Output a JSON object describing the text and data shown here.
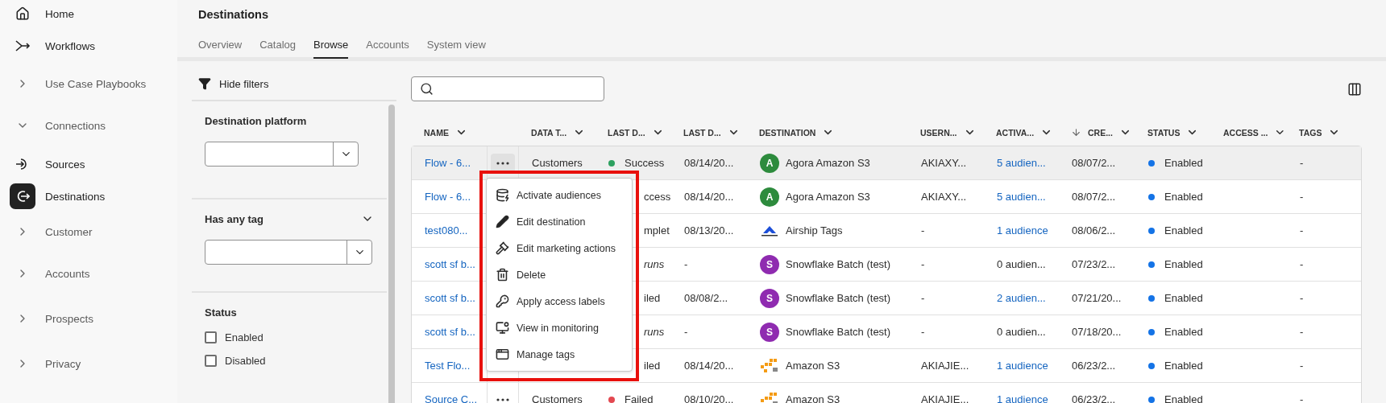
{
  "sidebar": {
    "items": [
      {
        "label": "Home",
        "kind": "link",
        "selected": false
      },
      {
        "label": "Workflows",
        "kind": "link",
        "selected": false
      },
      {
        "label": "Use Case Playbooks",
        "kind": "group",
        "expanded": false,
        "selected": false
      },
      {
        "label": "Connections",
        "kind": "group",
        "expanded": true,
        "selected": false
      },
      {
        "label": "Sources",
        "kind": "link",
        "selected": false
      },
      {
        "label": "Destinations",
        "kind": "link",
        "selected": true
      },
      {
        "label": "Customer",
        "kind": "group",
        "expanded": false,
        "selected": false
      },
      {
        "label": "Accounts",
        "kind": "group",
        "expanded": false,
        "selected": false
      },
      {
        "label": "Prospects",
        "kind": "group",
        "expanded": false,
        "selected": false
      },
      {
        "label": "Privacy",
        "kind": "group",
        "expanded": false,
        "selected": false
      }
    ]
  },
  "page": {
    "title": "Destinations"
  },
  "tabs": [
    {
      "label": "Overview",
      "selected": false
    },
    {
      "label": "Catalog",
      "selected": false
    },
    {
      "label": "Browse",
      "selected": true
    },
    {
      "label": "Accounts",
      "selected": false
    },
    {
      "label": "System view",
      "selected": false
    }
  ],
  "filters": {
    "toggle": "Hide filters",
    "sections": [
      {
        "kind": "select",
        "label": "Destination platform"
      },
      {
        "kind": "select",
        "label": "Has any tag",
        "expanded": true
      },
      {
        "kind": "checks",
        "label": "Status",
        "options": [
          {
            "label": "Enabled",
            "checked": false
          },
          {
            "label": "Disabled",
            "checked": false
          }
        ]
      }
    ]
  },
  "table": {
    "columns": [
      {
        "label": "NAME",
        "sorted": false
      },
      {},
      {
        "label": "DATA T...",
        "sorted": false
      },
      {
        "label": "LAST D...",
        "sorted": false
      },
      {
        "label": "LAST D...",
        "sorted": false
      },
      {
        "label": "DESTINATION",
        "sorted": false
      },
      {
        "label": "USERN...",
        "sorted": false
      },
      {
        "label": "ACTIVA...",
        "sorted": false
      },
      {
        "label": "CRE...",
        "sorted": true
      },
      {
        "label": "STATUS",
        "sorted": false
      },
      {
        "label": "ACCESS ...",
        "sorted": false
      },
      {
        "label": "TAGS",
        "sorted": false
      }
    ],
    "rows": [
      {
        "name": "Flow - 6...",
        "selected": true,
        "more": {
          "active": true
        },
        "data_type": "Customers",
        "last_status": {
          "text": "Success",
          "color": "#2da160",
          "italic": false
        },
        "last_date": "08/14/20...",
        "destination": {
          "name": "Agora Amazon S3",
          "kind": "letter",
          "letter": "A",
          "color": "#2d8b3d"
        },
        "username": "AKIAXY...",
        "activation": {
          "text": "5 audien...",
          "link": true
        },
        "created": "08/07/2...",
        "status": {
          "text": "Enabled",
          "color": "#1473e6"
        },
        "tags": "-"
      },
      {
        "name": "Flow - 6...",
        "selected": false,
        "last_status": {
          "text": "ccess",
          "italic": false
        },
        "last_date": "08/14/20...",
        "destination": {
          "name": "Agora Amazon S3",
          "kind": "letter",
          "letter": "A",
          "color": "#2d8b3d"
        },
        "username": "AKIAXY...",
        "activation": {
          "text": "5 audien...",
          "link": true
        },
        "created": "08/07/2...",
        "status": {
          "text": "Enabled",
          "color": "#1473e6"
        },
        "tags": "-"
      },
      {
        "name": "test080...",
        "selected": false,
        "last_status": {
          "text": "mplet",
          "italic": false
        },
        "last_date": "08/13/20...",
        "destination": {
          "name": "Airship Tags",
          "kind": "airship"
        },
        "username": "-",
        "activation": {
          "text": "1 audience",
          "link": true
        },
        "created": "08/06/2...",
        "status": {
          "text": "Enabled",
          "color": "#1473e6"
        },
        "tags": "-"
      },
      {
        "name": "scott sf b...",
        "selected": false,
        "last_status": {
          "text": "runs",
          "italic": true
        },
        "last_date": "-",
        "destination": {
          "name": "Snowflake Batch (test)",
          "kind": "letter",
          "letter": "S",
          "color": "#8f2bb0"
        },
        "username": "-",
        "activation": {
          "text": "0 audien...",
          "link": false
        },
        "created": "07/23/2...",
        "status": {
          "text": "Enabled",
          "color": "#1473e6"
        },
        "tags": "-"
      },
      {
        "name": "scott sf b...",
        "selected": false,
        "last_status": {
          "text": "iled",
          "italic": false
        },
        "last_date": "08/08/2...",
        "destination": {
          "name": "Snowflake Batch (test)",
          "kind": "letter",
          "letter": "S",
          "color": "#8f2bb0"
        },
        "username": "-",
        "activation": {
          "text": "2 audien...",
          "link": true
        },
        "created": "07/21/20...",
        "status": {
          "text": "Enabled",
          "color": "#1473e6"
        },
        "tags": "-"
      },
      {
        "name": "scott sf b...",
        "selected": false,
        "last_status": {
          "text": "runs",
          "italic": true
        },
        "last_date": "-",
        "destination": {
          "name": "Snowflake Batch (test)",
          "kind": "letter",
          "letter": "S",
          "color": "#8f2bb0"
        },
        "username": "-",
        "activation": {
          "text": "0 audien...",
          "link": false
        },
        "created": "07/18/20...",
        "status": {
          "text": "Enabled",
          "color": "#1473e6"
        },
        "tags": "-"
      },
      {
        "name": "Test Flo...",
        "selected": false,
        "last_status": {
          "text": "iled",
          "italic": false
        },
        "last_date": "08/14/20...",
        "destination": {
          "name": "Amazon S3",
          "kind": "s3"
        },
        "username": "AKIAJIE...",
        "activation": {
          "text": "1 audience",
          "link": true
        },
        "created": "06/23/2...",
        "status": {
          "text": "Enabled",
          "color": "#1473e6"
        },
        "tags": "-"
      },
      {
        "name": "Source C...",
        "selected": false,
        "more": {
          "active": false
        },
        "data_type": "Customers",
        "last_status": {
          "text": "Failed",
          "color": "#e34850",
          "italic": false
        },
        "last_date": "08/10/20...",
        "destination": {
          "name": "Amazon S3",
          "kind": "s3"
        },
        "username": "AKIAJIE...",
        "activation": {
          "text": "1 audience",
          "link": true
        },
        "created": "06/23/2...",
        "status": {
          "text": "Enabled",
          "color": "#1473e6"
        },
        "tags": "-"
      }
    ]
  },
  "context_menu": {
    "items": [
      {
        "label": "Activate audiences"
      },
      {
        "label": "Edit destination"
      },
      {
        "label": "Edit marketing actions"
      },
      {
        "label": "Delete"
      },
      {
        "label": "Apply access labels"
      },
      {
        "label": "View in monitoring"
      },
      {
        "label": "Manage tags"
      }
    ]
  }
}
